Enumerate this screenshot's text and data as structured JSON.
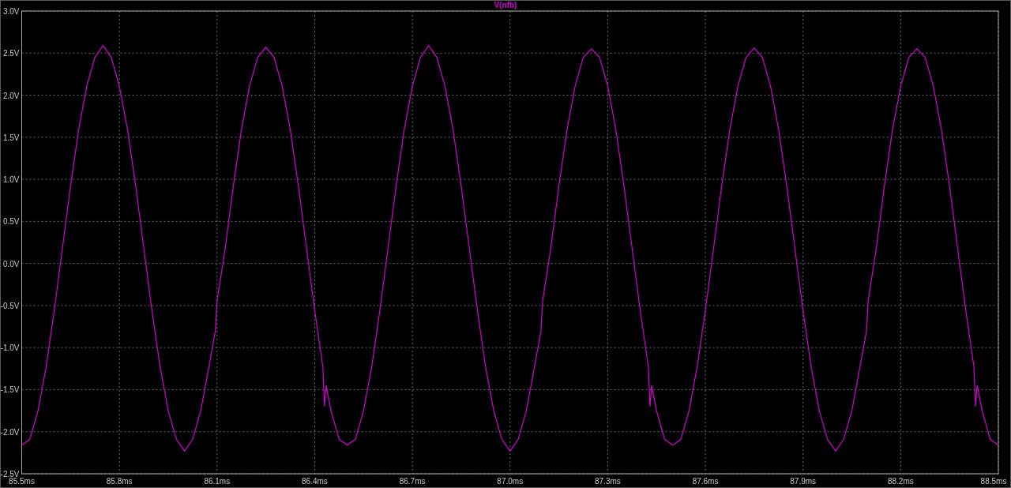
{
  "plot": {
    "chart_data": {
      "type": "line",
      "grid": true,
      "xlim": [
        85.5,
        88.5
      ],
      "ylim": [
        -2.5,
        3.0
      ],
      "xticks": [
        {
          "value": 85.5,
          "label": "85.5ms"
        },
        {
          "value": 85.8,
          "label": "85.8ms"
        },
        {
          "value": 86.1,
          "label": "86.1ms"
        },
        {
          "value": 86.4,
          "label": "86.4ms"
        },
        {
          "value": 86.7,
          "label": "86.7ms"
        },
        {
          "value": 87.0,
          "label": "87.0ms"
        },
        {
          "value": 87.3,
          "label": "87.3ms"
        },
        {
          "value": 87.6,
          "label": "87.6ms"
        },
        {
          "value": 87.9,
          "label": "87.9ms"
        },
        {
          "value": 88.2,
          "label": "88.2ms"
        },
        {
          "value": 88.5,
          "label": "88.5ms"
        }
      ],
      "yticks": [
        {
          "value": 3.0,
          "label": "3.0V"
        },
        {
          "value": 2.5,
          "label": "2.5V"
        },
        {
          "value": 2.0,
          "label": "2.0V"
        },
        {
          "value": 1.5,
          "label": "1.5V"
        },
        {
          "value": 1.0,
          "label": "1.0V"
        },
        {
          "value": 0.5,
          "label": "0.5V"
        },
        {
          "value": 0.0,
          "label": "0.0V"
        },
        {
          "value": -0.5,
          "label": "-0.5V"
        },
        {
          "value": -1.0,
          "label": "-1.0V"
        },
        {
          "value": -1.5,
          "label": "-1.5V"
        },
        {
          "value": -2.0,
          "label": "-2.0V"
        },
        {
          "value": -2.5,
          "label": "-2.5V"
        }
      ],
      "x": [
        85.5,
        85.525,
        85.55,
        85.575,
        85.6,
        85.625,
        85.65,
        85.675,
        85.7,
        85.725,
        85.75,
        85.775,
        85.8,
        85.825,
        85.85,
        85.875,
        85.9,
        85.925,
        85.95,
        85.975,
        86.0,
        86.025,
        86.05,
        86.075,
        86.095,
        86.1,
        86.125,
        86.15,
        86.175,
        86.2,
        86.225,
        86.25,
        86.275,
        86.3,
        86.325,
        86.35,
        86.375,
        86.4,
        86.425,
        86.43,
        86.435,
        86.45,
        86.475,
        86.5,
        86.525,
        86.55,
        86.575,
        86.6,
        86.625,
        86.65,
        86.675,
        86.7,
        86.725,
        86.75,
        86.775,
        86.8,
        86.825,
        86.85,
        86.875,
        86.9,
        86.925,
        86.95,
        86.975,
        87.0,
        87.025,
        87.05,
        87.075,
        87.095,
        87.1,
        87.125,
        87.15,
        87.175,
        87.2,
        87.225,
        87.25,
        87.275,
        87.3,
        87.325,
        87.35,
        87.375,
        87.4,
        87.425,
        87.43,
        87.435,
        87.45,
        87.475,
        87.5,
        87.525,
        87.55,
        87.575,
        87.6,
        87.625,
        87.65,
        87.675,
        87.7,
        87.725,
        87.75,
        87.775,
        87.8,
        87.825,
        87.85,
        87.875,
        87.9,
        87.925,
        87.95,
        87.975,
        88.0,
        88.025,
        88.05,
        88.075,
        88.095,
        88.1,
        88.125,
        88.15,
        88.175,
        88.2,
        88.225,
        88.25,
        88.275,
        88.3,
        88.325,
        88.35,
        88.375,
        88.4,
        88.425,
        88.43,
        88.435,
        88.45,
        88.475,
        88.5
      ],
      "series": [
        {
          "name": "V(nfb)",
          "color": "#d400d4",
          "values": [
            -2.16,
            -2.09,
            -1.75,
            -1.23,
            -0.56,
            0.18,
            0.92,
            1.59,
            2.11,
            2.45,
            2.59,
            2.45,
            2.11,
            1.59,
            0.92,
            0.18,
            -0.56,
            -1.23,
            -1.75,
            -2.09,
            -2.23,
            -2.09,
            -1.75,
            -1.23,
            -0.8,
            -0.45,
            0.18,
            0.92,
            1.59,
            2.11,
            2.45,
            2.57,
            2.45,
            2.11,
            1.59,
            0.92,
            0.18,
            -0.56,
            -1.23,
            -1.7,
            -1.45,
            -1.75,
            -2.09,
            -2.16,
            -2.09,
            -1.75,
            -1.23,
            -0.56,
            0.18,
            0.92,
            1.59,
            2.11,
            2.45,
            2.59,
            2.45,
            2.11,
            1.59,
            0.92,
            0.18,
            -0.56,
            -1.23,
            -1.75,
            -2.09,
            -2.23,
            -2.09,
            -1.75,
            -1.23,
            -0.8,
            -0.45,
            0.18,
            0.92,
            1.59,
            2.11,
            2.45,
            2.55,
            2.45,
            2.11,
            1.59,
            0.92,
            0.18,
            -0.56,
            -1.23,
            -1.7,
            -1.45,
            -1.75,
            -2.09,
            -2.16,
            -2.09,
            -1.75,
            -1.23,
            -0.56,
            0.18,
            0.92,
            1.59,
            2.11,
            2.45,
            2.56,
            2.45,
            2.11,
            1.59,
            0.92,
            0.18,
            -0.56,
            -1.23,
            -1.75,
            -2.09,
            -2.23,
            -2.09,
            -1.75,
            -1.23,
            -0.8,
            -0.45,
            0.18,
            0.92,
            1.59,
            2.11,
            2.45,
            2.55,
            2.45,
            2.11,
            1.59,
            0.92,
            0.18,
            -0.56,
            -1.23,
            -1.7,
            -1.45,
            -1.75,
            -2.09,
            -2.16
          ]
        }
      ]
    }
  }
}
